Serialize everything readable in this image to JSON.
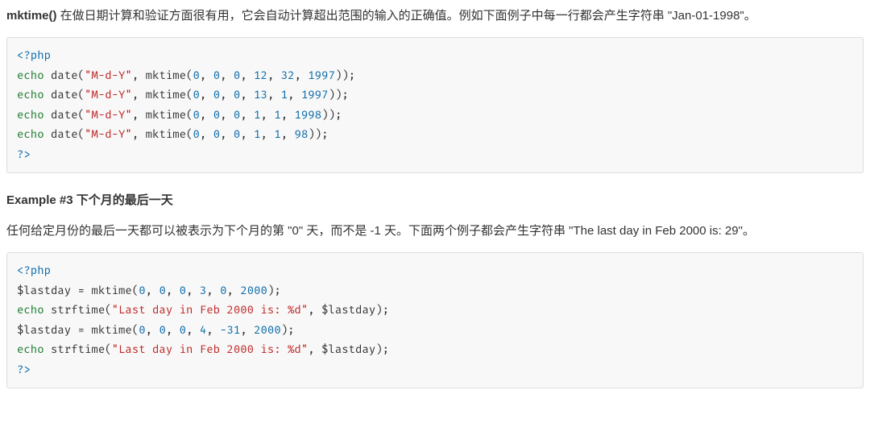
{
  "para1": {
    "strong": "mktime()",
    "text_after": " 在做日期计算和验证方面很有用，它会自动计算超出范围的输入的正确值。例如下面例子中每一行都会产生字符串 \"Jan-01-1998\"。"
  },
  "code1": {
    "open": "<?php",
    "lines": [
      {
        "fn": "echo",
        "call": "date",
        "str": "\"M-d-Y\"",
        "sub": "mktime",
        "nums": [
          "0",
          "0",
          "0",
          "12",
          "32",
          "1997"
        ]
      },
      {
        "fn": "echo",
        "call": "date",
        "str": "\"M-d-Y\"",
        "sub": "mktime",
        "nums": [
          "0",
          "0",
          "0",
          "13",
          "1",
          "1997"
        ]
      },
      {
        "fn": "echo",
        "call": "date",
        "str": "\"M-d-Y\"",
        "sub": "mktime",
        "nums": [
          "0",
          "0",
          "0",
          "1",
          "1",
          "1998"
        ]
      },
      {
        "fn": "echo",
        "call": "date",
        "str": "\"M-d-Y\"",
        "sub": "mktime",
        "nums": [
          "0",
          "0",
          "0",
          "1",
          "1",
          "98"
        ]
      }
    ],
    "close": "?>"
  },
  "example3": {
    "label": "Example #3",
    "title": " 下个月的最后一天"
  },
  "para2": "任何给定月份的最后一天都可以被表示为下个月的第 \"0\" 天，而不是 -1 天。下面两个例子都会产生字符串 \"The last day in Feb 2000 is: 29\"。",
  "code2": {
    "open": "<?php",
    "l1": {
      "var": "$lastday",
      "fn": "mktime",
      "nums": [
        "0",
        "0",
        "0",
        "3",
        "0",
        "2000"
      ]
    },
    "l2": {
      "kw": "echo",
      "fn": "strftime",
      "str": "\"Last day in Feb 2000 is: %d\"",
      "arg": "$lastday"
    },
    "l3": {
      "var": "$lastday",
      "fn": "mktime",
      "nums": [
        "0",
        "0",
        "0",
        "4",
        "-31",
        "2000"
      ]
    },
    "l4": {
      "kw": "echo",
      "fn": "strftime",
      "str": "\"Last day in Feb 2000 is: %d\"",
      "arg": "$lastday"
    },
    "close": "?>"
  }
}
